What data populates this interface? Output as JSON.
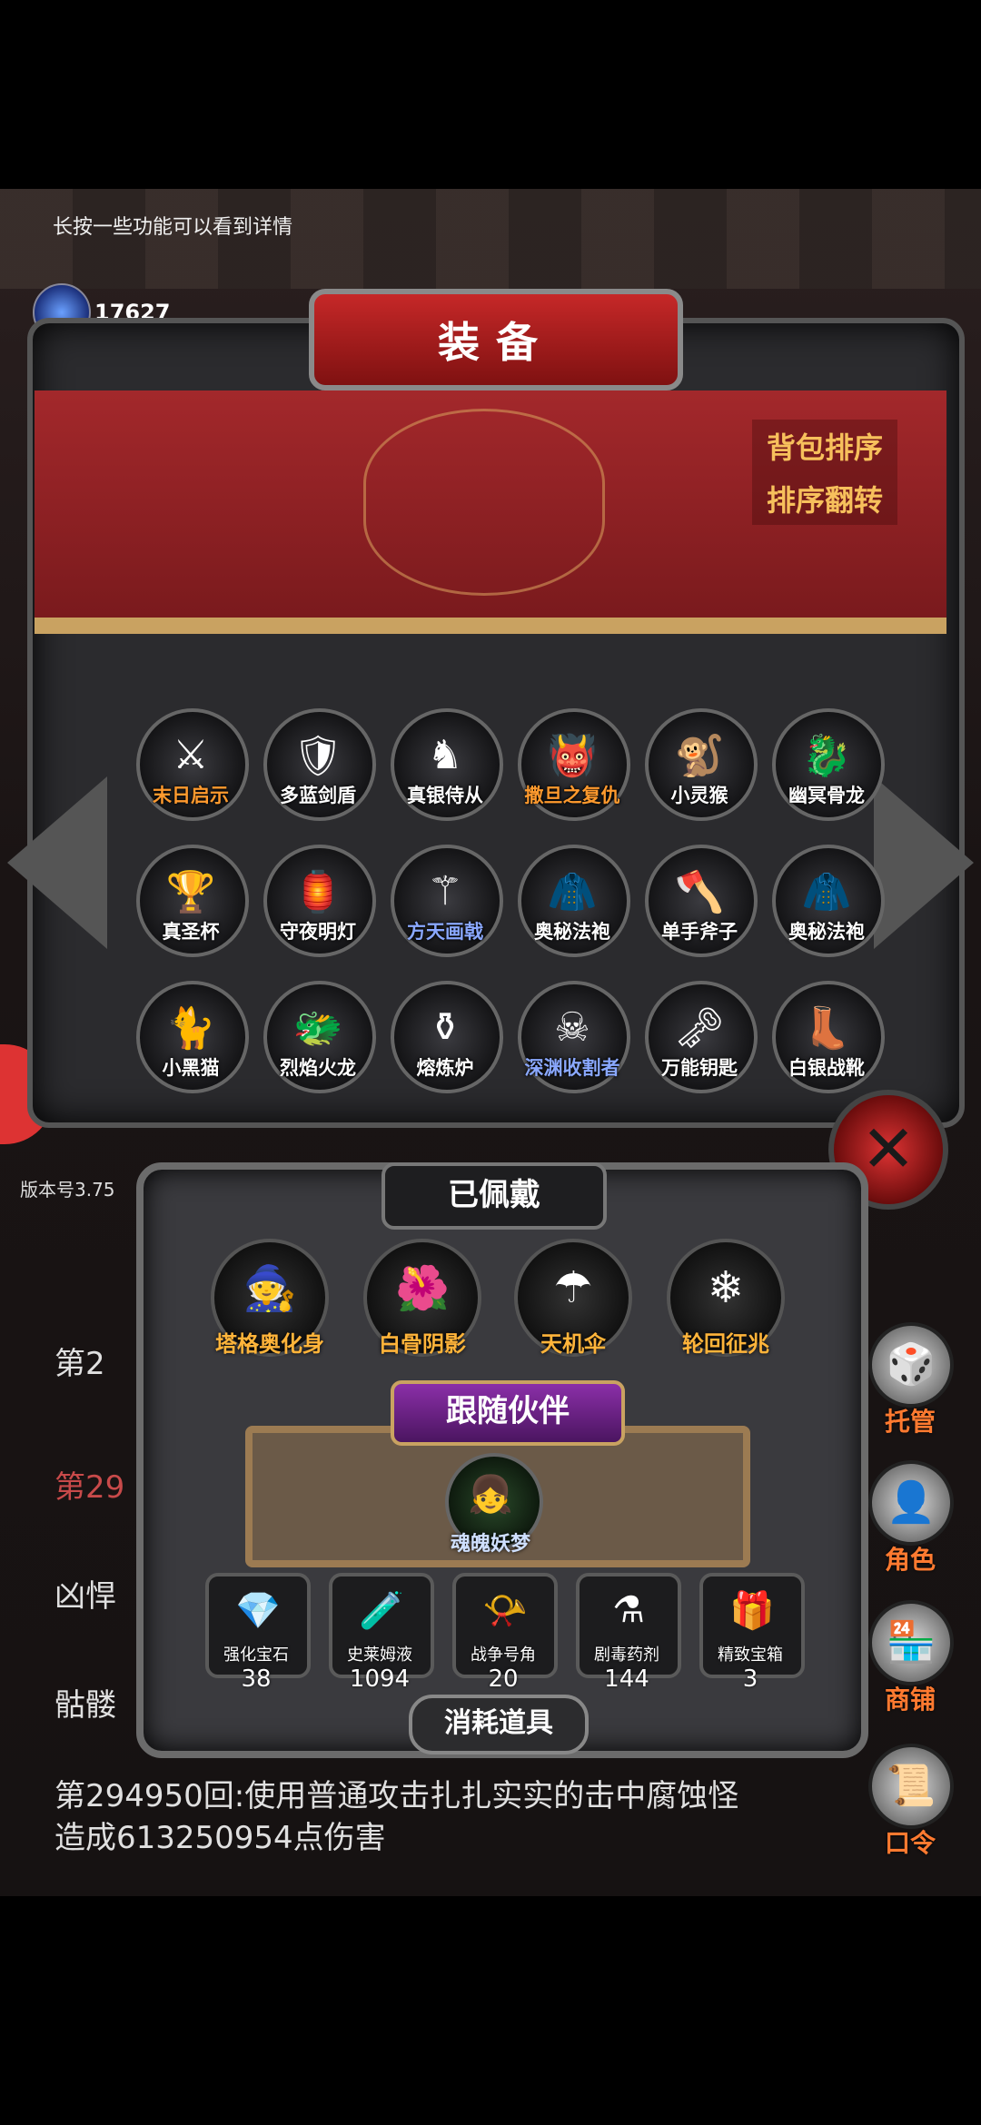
{
  "hint": "长按一些功能可以看到详情",
  "gems": {
    "label": "宝石",
    "count": "17627"
  },
  "panel": {
    "title": "装备",
    "sort_label": "背包排序",
    "flip_label": "排序翻转"
  },
  "items": [
    {
      "label": "末日启示",
      "color": "orange",
      "icon": "halberd-icon",
      "glyph": "⚔"
    },
    {
      "label": "多蓝剑盾",
      "color": "white",
      "icon": "shield-icon",
      "glyph": "🛡"
    },
    {
      "label": "真银侍从",
      "color": "white",
      "icon": "knight-icon",
      "glyph": "♞"
    },
    {
      "label": "撒旦之复仇",
      "color": "orange",
      "icon": "demon-icon",
      "glyph": "👹"
    },
    {
      "label": "小灵猴",
      "color": "white",
      "icon": "monkey-icon",
      "glyph": "🐒"
    },
    {
      "label": "幽冥骨龙",
      "color": "white",
      "icon": "bone-dragon-icon",
      "glyph": "🐉"
    },
    {
      "label": "真圣杯",
      "color": "white",
      "icon": "grail-icon",
      "glyph": "🏆"
    },
    {
      "label": "守夜明灯",
      "color": "white",
      "icon": "lantern-icon",
      "glyph": "🏮"
    },
    {
      "label": "方天画戟",
      "color": "blue",
      "icon": "spear-icon",
      "glyph": "⚚"
    },
    {
      "label": "奥秘法袍",
      "color": "white",
      "icon": "robe-icon",
      "glyph": "🧥"
    },
    {
      "label": "单手斧子",
      "color": "white",
      "icon": "axe-icon",
      "glyph": "🪓"
    },
    {
      "label": "奥秘法袍",
      "color": "white",
      "icon": "robe-icon",
      "glyph": "🧥"
    },
    {
      "label": "小黑猫",
      "color": "white",
      "icon": "cat-icon",
      "glyph": "🐈"
    },
    {
      "label": "烈焰火龙",
      "color": "white",
      "icon": "fire-dragon-icon",
      "glyph": "🐲"
    },
    {
      "label": "熔炼炉",
      "color": "white",
      "icon": "furnace-icon",
      "glyph": "⚱"
    },
    {
      "label": "深渊收割者",
      "color": "blue",
      "icon": "reaper-icon",
      "glyph": "☠"
    },
    {
      "label": "万能钥匙",
      "color": "white",
      "icon": "key-icon",
      "glyph": "🗝"
    },
    {
      "label": "白银战靴",
      "color": "white",
      "icon": "boots-icon",
      "glyph": "👢"
    }
  ],
  "version": "版本号3.75",
  "equipped": {
    "title": "已佩戴",
    "items": [
      {
        "label": "塔格奥化身",
        "icon": "avatar-icon",
        "glyph": "🧙"
      },
      {
        "label": "白骨阴影",
        "icon": "flower-icon",
        "glyph": "🌺"
      },
      {
        "label": "天机伞",
        "icon": "umbrella-icon",
        "glyph": "☂"
      },
      {
        "label": "轮回征兆",
        "icon": "ice-staff-icon",
        "glyph": "❄"
      }
    ]
  },
  "follow": {
    "title": "跟随伙伴",
    "companion": {
      "label": "魂魄妖梦",
      "icon": "companion-icon",
      "glyph": "👧"
    }
  },
  "consumables": {
    "title": "消耗道具",
    "items": [
      {
        "label": "强化宝石",
        "count": "38",
        "icon": "gem-icon",
        "glyph": "💎"
      },
      {
        "label": "史莱姆液",
        "count": "1094",
        "icon": "potion-icon",
        "glyph": "🧪"
      },
      {
        "label": "战争号角",
        "count": "20",
        "icon": "horn-icon",
        "glyph": "📯"
      },
      {
        "label": "剧毒药剂",
        "count": "144",
        "icon": "poison-icon",
        "glyph": "⚗"
      },
      {
        "label": "精致宝箱",
        "count": "3",
        "icon": "chest-icon",
        "glyph": "🎁"
      }
    ]
  },
  "log": {
    "line1": "第2",
    "line2": "第29",
    "line3": "凶悍",
    "line4": "骷髅",
    "line5": "第294950回:使用普通攻击扎扎实实的击中腐蚀怪",
    "line6": "造成613250954点伤害"
  },
  "menu": [
    {
      "label": "托管",
      "icon": "dice-icon",
      "glyph": "🎲"
    },
    {
      "label": "角色",
      "icon": "character-icon",
      "glyph": "👤"
    },
    {
      "label": "商铺",
      "icon": "shop-icon",
      "glyph": "🏪"
    },
    {
      "label": "口令",
      "icon": "scroll-icon",
      "glyph": "📜"
    }
  ]
}
